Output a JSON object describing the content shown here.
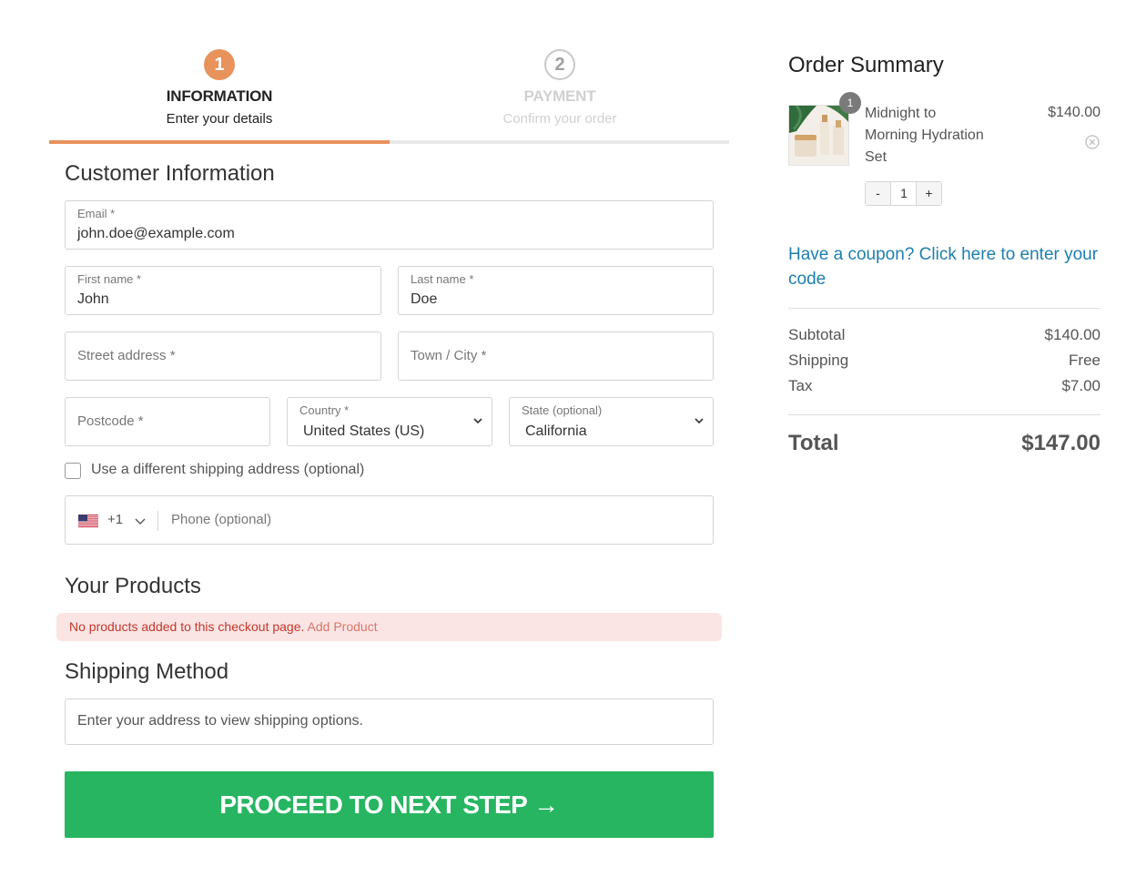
{
  "steps": [
    {
      "number": "1",
      "title": "INFORMATION",
      "subtitle": "Enter your details"
    },
    {
      "number": "2",
      "title": "PAYMENT",
      "subtitle": "Confirm your order"
    }
  ],
  "customer": {
    "heading": "Customer Information",
    "email": {
      "label": "Email *",
      "value": "john.doe@example.com"
    },
    "first_name": {
      "label": "First name *",
      "value": "John"
    },
    "last_name": {
      "label": "Last name *",
      "value": "Doe"
    },
    "street": {
      "placeholder": "Street address *"
    },
    "city": {
      "placeholder": "Town / City *"
    },
    "postcode": {
      "placeholder": "Postcode *"
    },
    "country": {
      "label": "Country *",
      "value": "United States (US)"
    },
    "state": {
      "label": "State (optional)",
      "value": "California"
    },
    "different_shipping_label": "Use a different shipping address (optional)",
    "phone": {
      "country_code": "+1",
      "placeholder": "Phone (optional)",
      "flag": "us-flag-icon"
    }
  },
  "products": {
    "heading": "Your Products",
    "alert_text": "No products added to this checkout page.",
    "alert_link": "Add Product"
  },
  "shipping": {
    "heading": "Shipping Method",
    "message": "Enter your address to view shipping options."
  },
  "proceed_label": "PROCEED TO NEXT STEP →",
  "summary": {
    "heading": "Order Summary",
    "item": {
      "name": "Midnight to Morning Hydration Set",
      "price": "$140.00",
      "quantity_badge": "1",
      "quantity": "1",
      "minus": "-",
      "plus": "+"
    },
    "coupon_text": "Have a coupon? Click here to enter your code",
    "subtotal": {
      "label": "Subtotal",
      "value": "$140.00"
    },
    "shipping": {
      "label": "Shipping",
      "value": "Free"
    },
    "tax": {
      "label": "Tax",
      "value": "$7.00"
    },
    "total": {
      "label": "Total",
      "value": "$147.00"
    }
  },
  "colors": {
    "accent": "#e8925c",
    "proceed": "#27b561",
    "link": "#1d7fae",
    "alert_bg": "#fbe4e4",
    "alert_text": "#c0392b"
  }
}
